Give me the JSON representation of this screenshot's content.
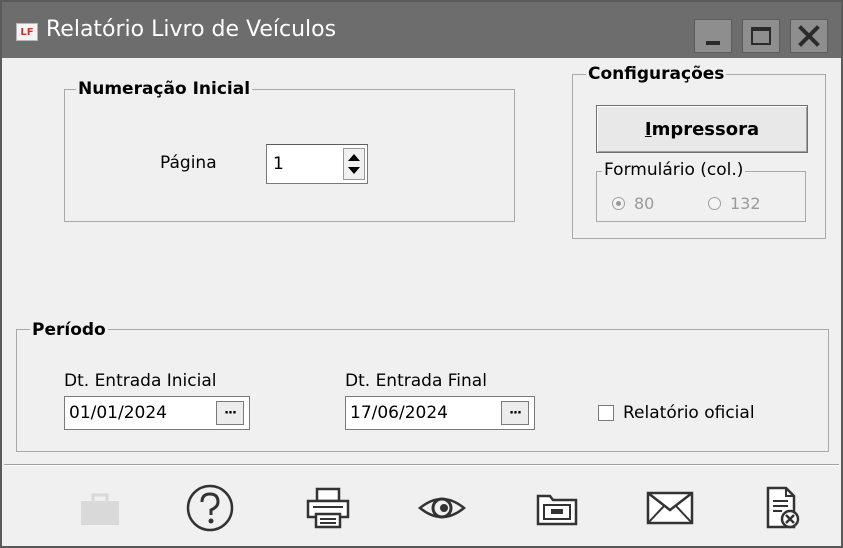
{
  "window": {
    "title": "Relatório Livro de Veículos",
    "icon_text": "LF"
  },
  "numeracao": {
    "legend": "Numeração Inicial",
    "pagina_label": "Página",
    "pagina_value": "1"
  },
  "configuracoes": {
    "legend": "Configurações",
    "impressora_underlined": "I",
    "impressora_rest": "mpressora",
    "formulario_legend": "Formulário (col.)",
    "option_80": "80",
    "option_132": "132",
    "selected": "80"
  },
  "periodo": {
    "legend": "Período",
    "inicial_label": "Dt. Entrada Inicial",
    "inicial_value": "01/01/2024",
    "final_label": "Dt. Entrada Final",
    "final_value": "17/06/2024",
    "ellipsis": "···",
    "oficial_label": "Relatório oficial",
    "oficial_checked": false
  },
  "toolbar": {
    "icons": [
      "briefcase-icon",
      "help-icon",
      "printer-icon",
      "preview-icon",
      "folder-icon",
      "mail-icon",
      "close-report-icon"
    ]
  },
  "colors": {
    "titlebar": "#6d6d6d",
    "window_bg": "#f0f0f0",
    "disabled": "#9a9a9a"
  }
}
